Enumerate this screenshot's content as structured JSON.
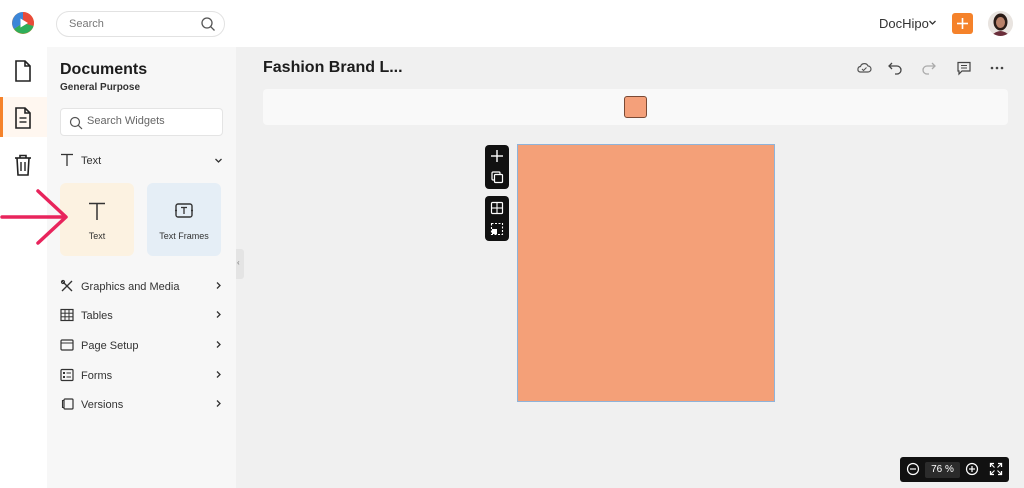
{
  "topbar": {
    "search_placeholder": "Search",
    "brand_name": "DocHipo",
    "icons": [
      "app-logo-icon",
      "search-icon",
      "chevron-down-icon",
      "plus-icon",
      "avatar"
    ]
  },
  "rail": {
    "items": [
      {
        "name": "document-icon",
        "active": false
      },
      {
        "name": "page-text-icon",
        "active": true
      },
      {
        "name": "trash-icon",
        "active": false
      }
    ]
  },
  "panel": {
    "title": "Documents",
    "subtitle": "General Purpose",
    "widget_search_placeholder": "Search Widgets",
    "text_section": {
      "label": "Text",
      "tiles": [
        {
          "label": "Text"
        },
        {
          "label": "Text Frames"
        }
      ]
    },
    "categories": [
      {
        "label": "Graphics and Media",
        "icon": "graphics-icon"
      },
      {
        "label": "Tables",
        "icon": "table-icon"
      },
      {
        "label": "Page Setup",
        "icon": "page-setup-icon"
      },
      {
        "label": "Forms",
        "icon": "form-icon"
      },
      {
        "label": "Versions",
        "icon": "versions-icon"
      }
    ]
  },
  "editor": {
    "doc_title": "Fashion Brand L...",
    "toolbar_icons": [
      "cloud-save-icon",
      "undo-icon",
      "redo-icon",
      "comment-icon",
      "more-icon"
    ],
    "fill_color": "#f4a078",
    "zoom": {
      "value": "76",
      "unit": "%"
    }
  },
  "colors": {
    "accent": "#f5822a",
    "artboard": "#f4a078",
    "arrow": "#e8245c"
  }
}
